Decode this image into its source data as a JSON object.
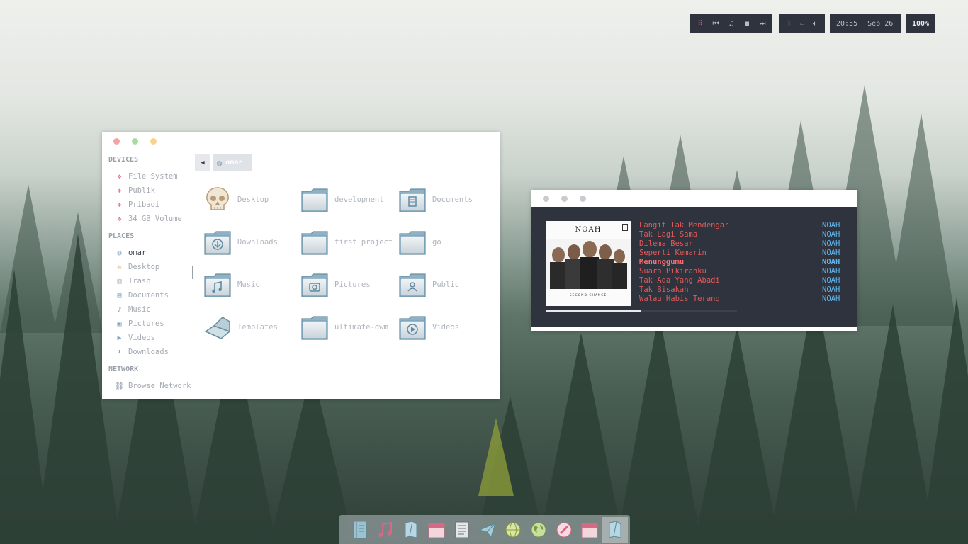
{
  "topbar": {
    "controls": [
      "apps-grid-icon",
      "prev-track-icon",
      "music-note-icon",
      "stop-icon",
      "next-track-icon"
    ],
    "status_icons": [
      "bluetooth-icon",
      "network-icon",
      "volume-icon"
    ],
    "time": "20:55",
    "date": "Sep 26",
    "battery": "100%"
  },
  "file_manager": {
    "sections": {
      "devices": "DEVICES",
      "places": "PLACES",
      "network": "NETWORK"
    },
    "devices": [
      "File System",
      "Publik",
      "Pribadi",
      "34 GB Volume"
    ],
    "places": [
      "omar",
      "Desktop",
      "Trash",
      "Documents",
      "Music",
      "Pictures",
      "Videos",
      "Downloads"
    ],
    "network": [
      "Browse Network"
    ],
    "location": "omar",
    "items": [
      {
        "label": "Desktop",
        "icon": "skull-icon"
      },
      {
        "label": "development",
        "icon": "folder-icon"
      },
      {
        "label": "Documents",
        "icon": "folder-documents-icon"
      },
      {
        "label": "Downloads",
        "icon": "folder-download-icon"
      },
      {
        "label": "first project",
        "icon": "folder-icon"
      },
      {
        "label": "go",
        "icon": "folder-icon"
      },
      {
        "label": "Music",
        "icon": "folder-music-icon"
      },
      {
        "label": "Pictures",
        "icon": "folder-pictures-icon"
      },
      {
        "label": "Public",
        "icon": "folder-public-icon"
      },
      {
        "label": "Templates",
        "icon": "scanner-icon"
      },
      {
        "label": "ultimate-dwm",
        "icon": "folder-icon"
      },
      {
        "label": "Videos",
        "icon": "folder-videos-icon"
      }
    ]
  },
  "music_player": {
    "album_band": "NOAH",
    "album_title": "SECOND CHANCE",
    "playing_index": 4,
    "progress": 0.5,
    "tracks": [
      {
        "title": "Langit Tak Mendengar",
        "artist": "NOAH"
      },
      {
        "title": "Tak Lagi Sama",
        "artist": "NOAH"
      },
      {
        "title": "Dilema Besar",
        "artist": "NOAH"
      },
      {
        "title": "Seperti Kemarin",
        "artist": "NOAH"
      },
      {
        "title": "Menunggumu",
        "artist": "NOAH"
      },
      {
        "title": "Suara Pikiranku",
        "artist": "NOAH"
      },
      {
        "title": "Tak Ada Yang Abadi",
        "artist": "NOAH"
      },
      {
        "title": "Tak Bisakah",
        "artist": "NOAH"
      },
      {
        "title": "Walau Habis Terang",
        "artist": "NOAH"
      }
    ]
  },
  "dock": [
    "notebook-icon",
    "music-icon",
    "files-icon",
    "calendar-icon",
    "document-icon",
    "telegram-icon",
    "globe-icon",
    "earth-icon",
    "pen-icon",
    "calendar-alt-icon",
    "files-active-icon"
  ],
  "colors": {
    "bar_bg": "#2f333d",
    "track_red": "#e05a5a",
    "artist_blue": "#5bb7ee",
    "folder_blue": "#7fa6bd"
  }
}
